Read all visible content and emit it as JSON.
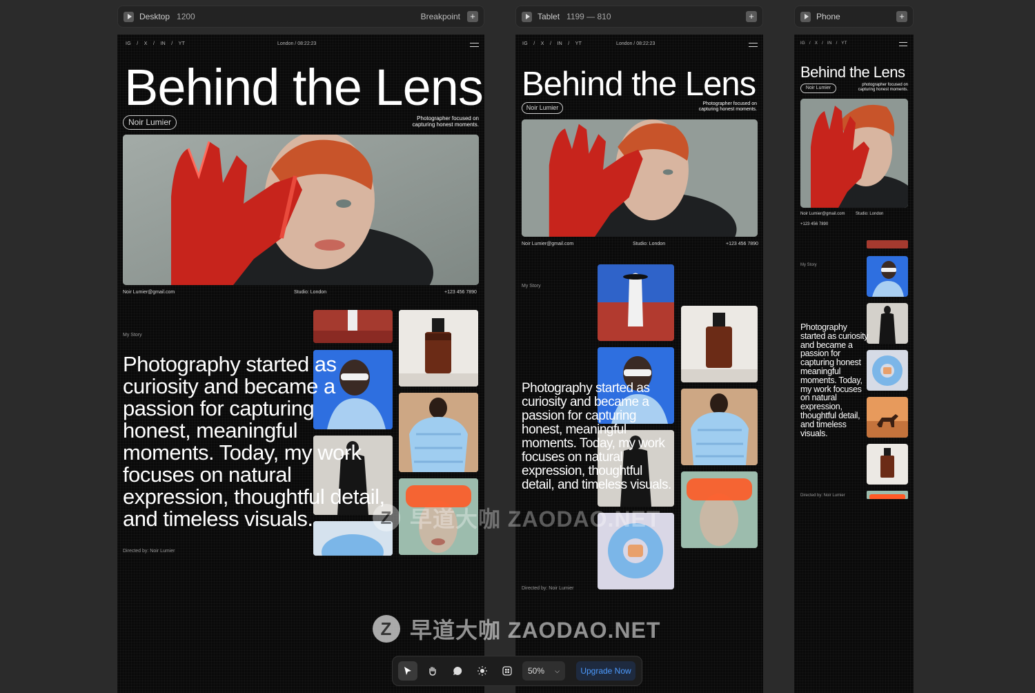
{
  "bars": {
    "desktop": {
      "name": "Desktop",
      "size": "1200",
      "breakpoint": "Breakpoint"
    },
    "tablet": {
      "name": "Tablet",
      "size": "1199 — 810"
    },
    "phone": {
      "name": "Phone"
    }
  },
  "site": {
    "social": "IG / X / IN / YT",
    "location": "London / 08:22:23",
    "title": "Behind the Lens",
    "name_pill": "Noir Lumier",
    "tagline_1": "Photographer focused on",
    "tagline_2": "capturing honest moments.",
    "tagline_1_phone": "photographer focused on",
    "email": "Noir Lumier@gmail.com",
    "studio": "Studio: London",
    "phone": "+123 456 7890",
    "story_label": "My Story",
    "story_desktop": [
      "Photography started as",
      "curiosity and became a",
      "passion for capturing",
      "honest, meaningful",
      "moments. Today, my work",
      "focuses on natural",
      "expression, thoughtful detail,",
      "and timeless visuals."
    ],
    "story_tablet": [
      "Photography started as",
      "curiosity and became a",
      "passion for capturing",
      "honest, meaningful",
      "moments. Today, my work",
      "focuses on natural",
      "expression, thoughtful",
      "detail, and timeless visuals."
    ],
    "story_phone": [
      "Photography",
      "started as curiosity",
      "and became a",
      "passion for",
      "capturing honest",
      "meaningful",
      "moments. Today,",
      "my work focuses",
      "on natural",
      "expression,",
      "thoughtful detail,",
      "and timeless",
      "visuals."
    ],
    "directed": "Directed by: Noir Lumier"
  },
  "toolbar": {
    "zoom": "50%",
    "upgrade": "Upgrade Now"
  },
  "watermark": {
    "text": "早道大咖  ZAODAO.NET",
    "logo": "Z"
  },
  "colors": {
    "red": "#c7241c",
    "blue": "#2e6fe0",
    "bg": "#0a0a0a"
  }
}
